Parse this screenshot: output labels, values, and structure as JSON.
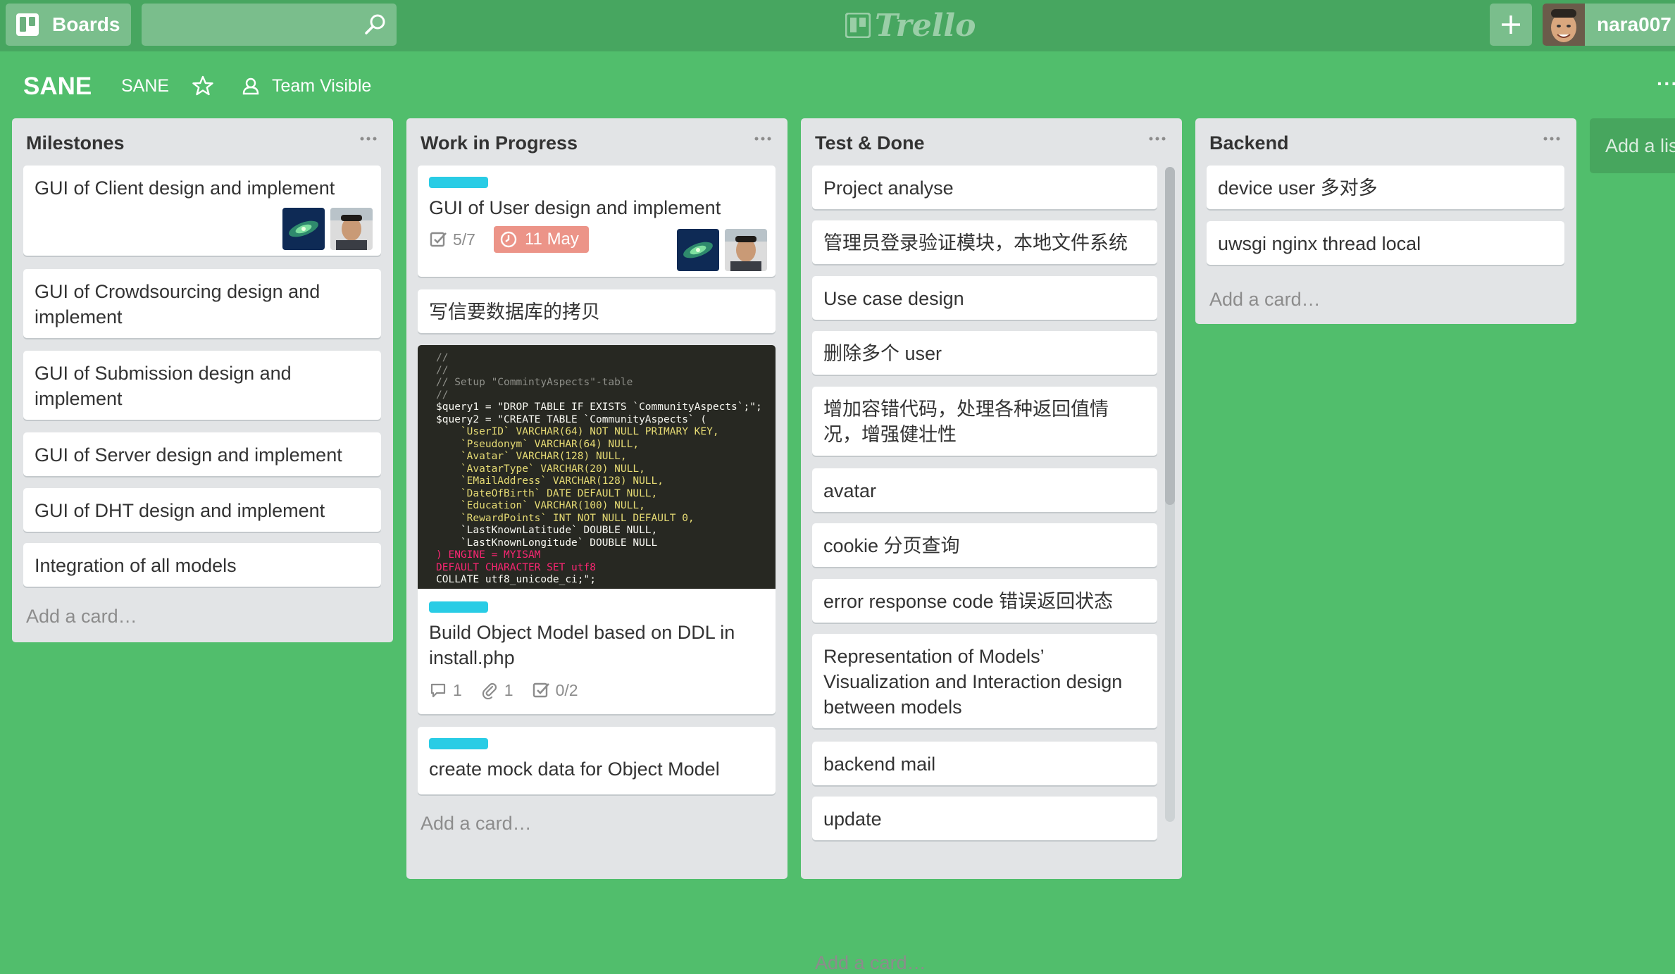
{
  "header": {
    "boards_label": "Boards",
    "search_value": "",
    "logo_text": "Trello",
    "username": "nara007"
  },
  "board": {
    "title": "SANE",
    "org": "SANE",
    "visibility": "Team Visible",
    "menu": "···"
  },
  "lists": [
    {
      "title": "Milestones",
      "add_card": "Add a card…",
      "cards": [
        "GUI of Client design and implement",
        "GUI of Crowdsourcing design and implement",
        "GUI of Submission design and implement",
        "GUI of Server design and implement",
        "GUI of DHT design and implement",
        "Integration of all models"
      ]
    },
    {
      "title": "Work in Progress",
      "add_card": "Add a card…",
      "cards": [
        {
          "title": "GUI of User design and implement",
          "label_color": "#29cce5",
          "checklist": "5/7",
          "due": "11 May"
        },
        {
          "title": "写信要数据库的拷贝"
        },
        {
          "title": "Build Object Model based on DDL in install.php",
          "label_color": "#29cce5",
          "comments": "1",
          "attachments": "1",
          "checklist": "0/2"
        },
        {
          "title": "create mock data for Object Model",
          "label_color": "#29cce5"
        }
      ],
      "code_cover": [
        "//",
        "//",
        "// Setup \"CommintyAspects\"-table",
        "//",
        "$query1 = \"DROP TABLE IF EXISTS `CommunityAspects`;\";",
        "$query2 = \"CREATE TABLE `CommunityAspects` (",
        "    `UserID` VARCHAR(64) NOT NULL PRIMARY KEY,",
        "    `Pseudonym` VARCHAR(64) NULL,",
        "    `Avatar` VARCHAR(128) NULL,",
        "    `AvatarType` VARCHAR(20) NULL,",
        "    `EMailAddress` VARCHAR(128) NULL,",
        "    `DateOfBirth` DATE DEFAULT NULL,",
        "    `Education` VARCHAR(100) NULL,",
        "    `RewardPoints` INT NOT NULL DEFAULT 0,",
        "    `LastKnownLatitude` DOUBLE NULL,",
        "    `LastKnownLongitude` DOUBLE NULL",
        ") ENGINE = MYISAM",
        "DEFAULT CHARACTER SET utf8",
        "COLLATE utf8_unicode_ci;\";"
      ]
    },
    {
      "title": "Test & Done",
      "add_card": "Add a card…",
      "cards": [
        "Project analyse",
        "管理员登录验证模块，本地文件系统",
        "Use case design",
        "删除多个 user",
        "增加容错代码，处理各种返回值情况，增强健壮性",
        "avatar",
        "cookie 分页查询",
        "error response code 错误返回状态",
        "Representation of Models’ Visualization and Interaction design between models",
        "backend mail",
        "update"
      ]
    },
    {
      "title": "Backend",
      "add_card": "Add a card…",
      "cards": [
        "device user 多对多",
        "uwsgi nginx thread local"
      ]
    }
  ],
  "add_list": "Add a list…",
  "colors": {
    "board_bg": "#51be6c",
    "header_bg": "#47a660",
    "label_blue": "#29cce5",
    "due_badge": "#ec9488"
  }
}
